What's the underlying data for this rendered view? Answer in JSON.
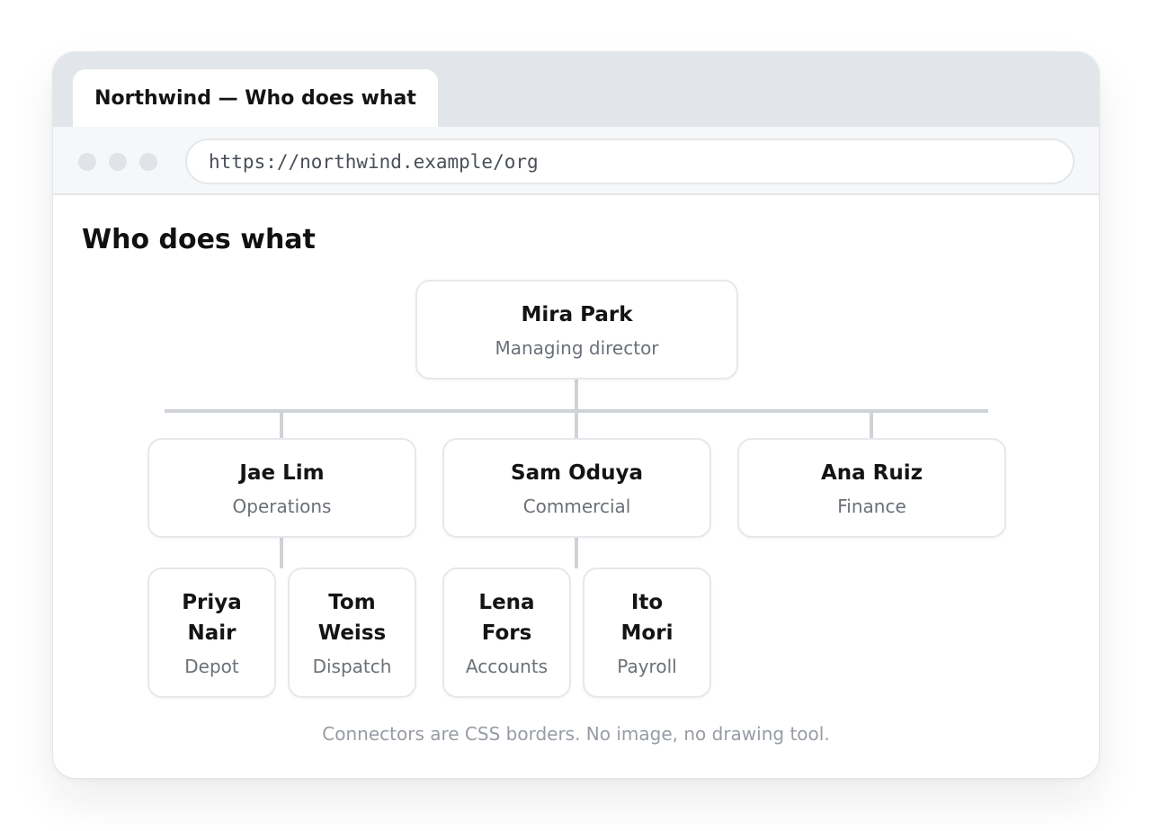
{
  "window": {
    "tab_title": "Northwind — Who does what",
    "url": "https://northwind.example/org"
  },
  "page": {
    "title": "Who does what",
    "footnote": "Connectors are CSS borders. No image, no drawing tool."
  },
  "org": {
    "root": {
      "name": "Mira Park",
      "role": "Managing director"
    },
    "heads": [
      {
        "name": "Jae Lim",
        "role": "Operations"
      },
      {
        "name": "Sam Oduya",
        "role": "Commercial"
      },
      {
        "name": "Ana Ruiz",
        "role": "Finance"
      }
    ],
    "reports": [
      {
        "name": "Priya Nair",
        "role": "Depot"
      },
      {
        "name": "Tom Weiss",
        "role": "Dispatch"
      },
      {
        "name": "Lena Fors",
        "role": "Accounts"
      },
      {
        "name": "Ito Mori",
        "role": "Payroll"
      }
    ]
  }
}
